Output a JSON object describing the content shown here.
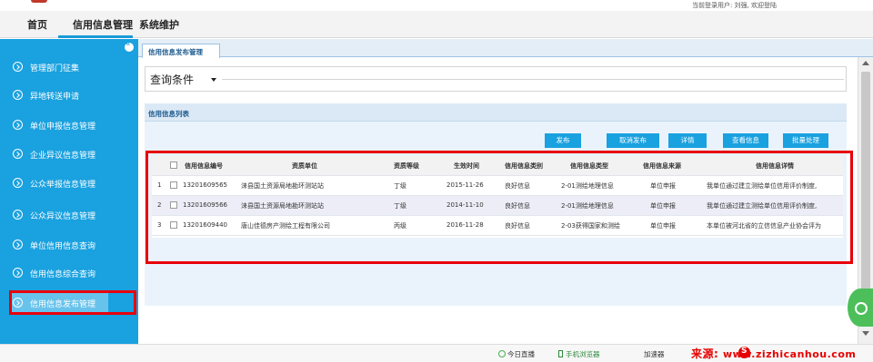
{
  "header": {
    "user_greeting": "当前登录用户: 刘强, 欢迎登陆"
  },
  "nav": {
    "tabs": [
      {
        "label": "首页"
      },
      {
        "label": "信用信息管理",
        "active": true
      },
      {
        "label": "系统维护"
      }
    ]
  },
  "sidebar": {
    "items": [
      {
        "label": "管理部门征集"
      },
      {
        "label": "异地转送申请"
      },
      {
        "label": "单位申报信息管理"
      },
      {
        "label": "企业异议信息管理"
      },
      {
        "label": "公众举报信息管理"
      },
      {
        "label": "公众异议信息管理"
      },
      {
        "label": "单位信用信息查询"
      },
      {
        "label": "信用信息综合查询"
      },
      {
        "label": "信用信息发布管理",
        "active": true
      }
    ]
  },
  "main": {
    "tab_label": "信用信息发布管理",
    "query_title": "查询条件",
    "list_title": "信用信息列表",
    "buttons": {
      "publish": "发布",
      "unpublish": "取消发布",
      "details": "详情",
      "view": "查看信息",
      "batch": "批量处理"
    },
    "table": {
      "columns": [
        "信用信息编号",
        "资质单位",
        "资质等级",
        "生效时间",
        "信用信息类别",
        "信用信息类型",
        "信用信息来源",
        "信用信息详情"
      ],
      "rows": [
        {
          "no": "1",
          "id": "13201609565",
          "unit": "涞县国土资源局地勘环测站站",
          "grade": "丁级",
          "date": "2015-11-26",
          "category": "良好信息",
          "type": "2-01测绘地理信息",
          "source": "单位申报",
          "detail": "我单位通过建立测绘单位信用评价制度,"
        },
        {
          "no": "2",
          "id": "13201609566",
          "unit": "涞县国土资源局地勘环测站站",
          "grade": "丁级",
          "date": "2014-11-10",
          "category": "良好信息",
          "type": "2-01测绘地理信息",
          "source": "单位申报",
          "detail": "我单位通过建立测绘单位信用评价制度,"
        },
        {
          "no": "3",
          "id": "13201609440",
          "unit": "唐山佳德房产测绘工程有限公司",
          "grade": "丙级",
          "date": "2016-11-28",
          "category": "良好信息",
          "type": "2-03获得国家和测绘",
          "source": "单位申报",
          "detail": "本单位被河北省的立信信息产业协会评为"
        }
      ]
    }
  },
  "status_bar": {
    "today": "今日直播",
    "browser": "手机浏览器",
    "speed": "加速器",
    "source_label": "来源:",
    "source_url": "www.zizhicanhou.com"
  },
  "colors": {
    "sidebar": "#1aa1df",
    "accent": "#1aa1df",
    "highlight": "#e8000b"
  }
}
